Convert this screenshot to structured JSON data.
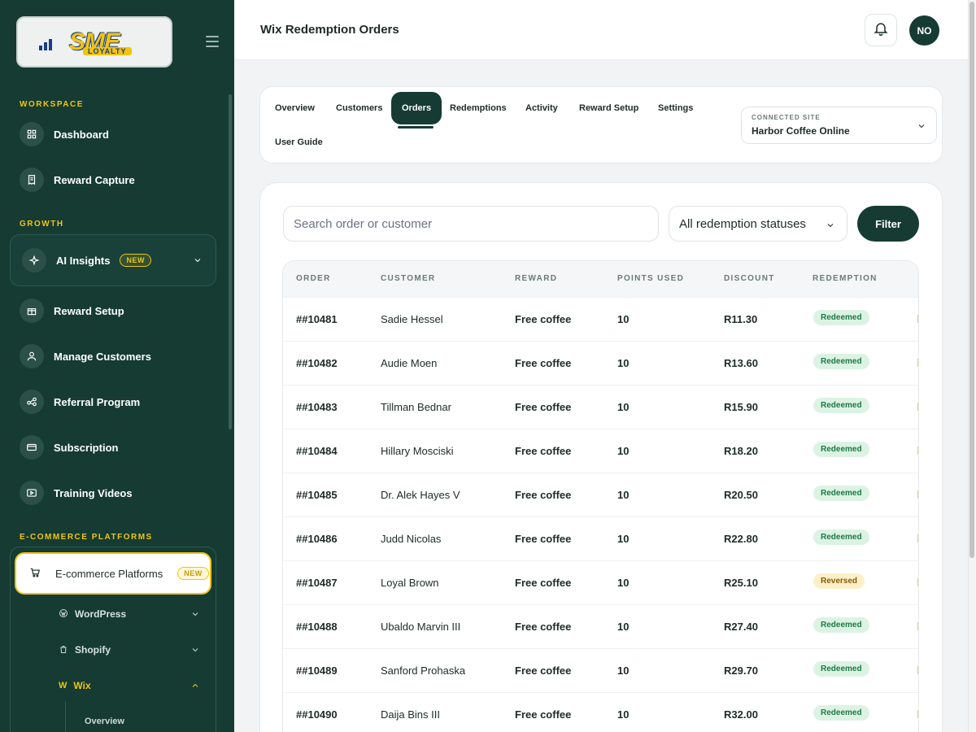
{
  "brand": {
    "logo_text": "SME",
    "logo_sub": "LOYALTY"
  },
  "sidebar": {
    "section_workspace": "WORKSPACE",
    "section_growth": "GROWTH",
    "section_ecommerce": "E-COMMERCE PLATFORMS",
    "items": [
      {
        "label": "Dashboard",
        "icon": "dashboard-icon"
      },
      {
        "label": "Reward Capture",
        "icon": "receipt-icon"
      },
      {
        "label": "AI Insights",
        "icon": "sparkle-icon",
        "badge": "NEW"
      },
      {
        "label": "Reward Setup",
        "icon": "gift-icon"
      },
      {
        "label": "Manage Customers",
        "icon": "user-icon"
      },
      {
        "label": "Referral Program",
        "icon": "share-icon"
      },
      {
        "label": "Subscription",
        "icon": "card-icon"
      },
      {
        "label": "Training Videos",
        "icon": "video-icon"
      }
    ],
    "ecommerce": {
      "label": "E-commerce Platforms",
      "badge": "NEW"
    },
    "platforms": [
      {
        "label": "WordPress",
        "icon": "wordpress-icon"
      },
      {
        "label": "Shopify",
        "icon": "shopify-icon"
      },
      {
        "label": "Wix",
        "icon": "wix-icon",
        "glyph": "W"
      }
    ],
    "wix_sub": [
      "Overview"
    ]
  },
  "header": {
    "title": "Wix Redemption Orders",
    "avatar": "NO"
  },
  "tabs": [
    "Overview",
    "Customers",
    "Orders",
    "Redemptions",
    "Activity",
    "Reward Setup",
    "Settings",
    "User Guide"
  ],
  "active_tab": "Orders",
  "site": {
    "label": "CONNECTED SITE",
    "value": "Harbor Coffee Online"
  },
  "toolbar": {
    "search_placeholder": "Search order or customer",
    "status_value": "All redemption statuses",
    "filter_label": "Filter"
  },
  "table": {
    "columns": [
      "ORDER",
      "CUSTOMER",
      "REWARD",
      "POINTS USED",
      "DISCOUNT",
      "REDEMPTION"
    ],
    "rows": [
      {
        "order": "##10481",
        "customer": "Sadie Hessel",
        "reward": "Free coffee",
        "points": "10",
        "discount": "R11.30",
        "status": "Redeemed"
      },
      {
        "order": "##10482",
        "customer": "Audie Moen",
        "reward": "Free coffee",
        "points": "10",
        "discount": "R13.60",
        "status": "Redeemed"
      },
      {
        "order": "##10483",
        "customer": "Tillman Bednar",
        "reward": "Free coffee",
        "points": "10",
        "discount": "R15.90",
        "status": "Redeemed"
      },
      {
        "order": "##10484",
        "customer": "Hillary Mosciski",
        "reward": "Free coffee",
        "points": "10",
        "discount": "R18.20",
        "status": "Redeemed"
      },
      {
        "order": "##10485",
        "customer": "Dr. Alek Hayes V",
        "reward": "Free coffee",
        "points": "10",
        "discount": "R20.50",
        "status": "Redeemed"
      },
      {
        "order": "##10486",
        "customer": "Judd Nicolas",
        "reward": "Free coffee",
        "points": "10",
        "discount": "R22.80",
        "status": "Redeemed"
      },
      {
        "order": "##10487",
        "customer": "Loyal Brown",
        "reward": "Free coffee",
        "points": "10",
        "discount": "R25.10",
        "status": "Reversed"
      },
      {
        "order": "##10488",
        "customer": "Ubaldo Marvin III",
        "reward": "Free coffee",
        "points": "10",
        "discount": "R27.40",
        "status": "Redeemed"
      },
      {
        "order": "##10489",
        "customer": "Sanford Prohaska",
        "reward": "Free coffee",
        "points": "10",
        "discount": "R29.70",
        "status": "Redeemed"
      },
      {
        "order": "##10490",
        "customer": "Daija Bins III",
        "reward": "Free coffee",
        "points": "10",
        "discount": "R32.00",
        "status": "Redeemed"
      }
    ]
  },
  "colors": {
    "primary": "#153b33",
    "accent": "#f1c40f",
    "redeemed_bg": "#dcf3e4",
    "reversed_bg": "#fdf0c8"
  }
}
